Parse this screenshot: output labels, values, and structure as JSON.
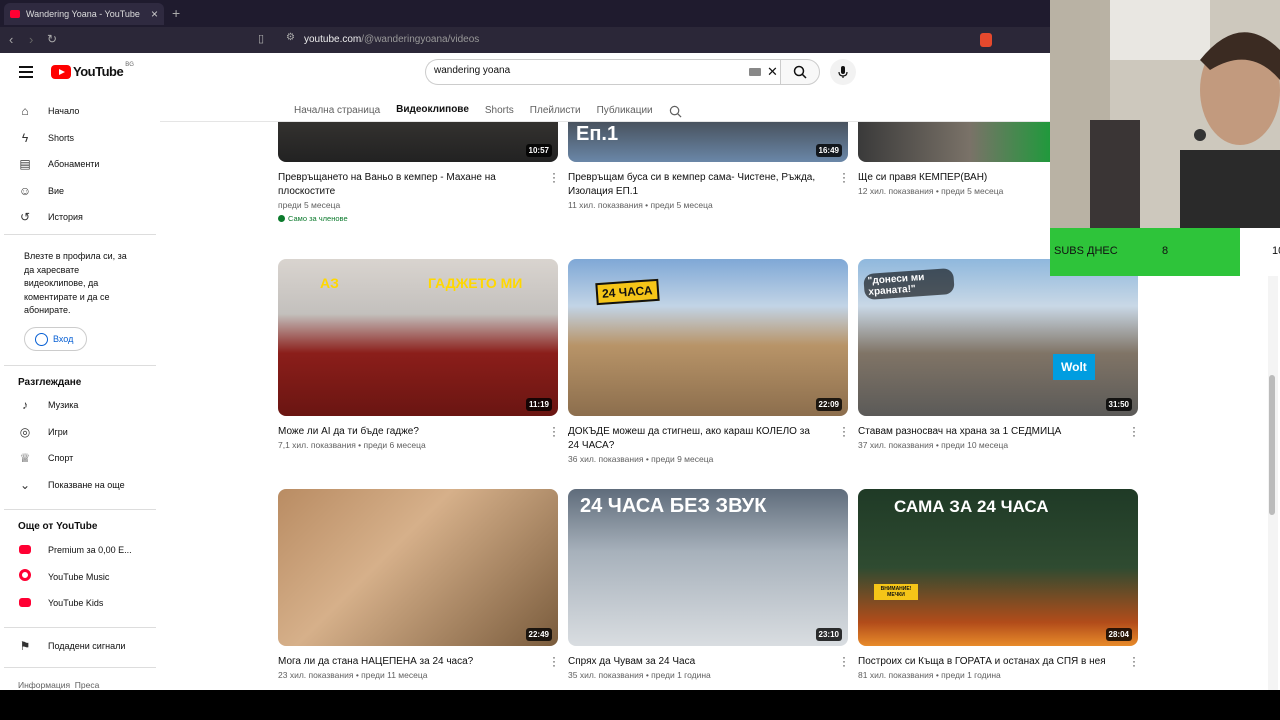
{
  "browser": {
    "tab_title": "Wandering Yoana - YouTube",
    "url_host": "youtube.com",
    "url_path": "/@wanderingyoana/videos"
  },
  "header": {
    "logo_text": "YouTube",
    "country_code": "BG",
    "search_value": "wandering yoana"
  },
  "sidebar": {
    "main_items": [
      {
        "label": "Начало",
        "icon": "home-icon"
      },
      {
        "label": "Shorts",
        "icon": "shorts-icon"
      },
      {
        "label": "Абонаменти",
        "icon": "subscriptions-icon"
      },
      {
        "label": "Вие",
        "icon": "you-icon"
      },
      {
        "label": "История",
        "icon": "history-icon"
      }
    ],
    "signin_note": "Влезте в профила си, за да харесвате видеоклипове, да коментирате и да се абонирате.",
    "signin_label": "Вход",
    "explore_heading": "Разглеждане",
    "explore_items": [
      {
        "label": "Музика",
        "icon": "music-icon"
      },
      {
        "label": "Игри",
        "icon": "gaming-icon"
      },
      {
        "label": "Спорт",
        "icon": "trophy-icon"
      },
      {
        "label": "Показване на още",
        "icon": "chevron-down-icon"
      }
    ],
    "more_heading": "Още от YouTube",
    "more_items": [
      {
        "label": "Premium за 0,00 Е...",
        "icon": "youtube-premium-icon"
      },
      {
        "label": "YouTube Music",
        "icon": "youtube-music-icon"
      },
      {
        "label": "YouTube Kids",
        "icon": "youtube-kids-icon"
      }
    ],
    "report_label": "Подадени сигнали",
    "footer_text": "Информация  Преса"
  },
  "channel_tabs": [
    "Начална страница",
    "Видеоклипове",
    "Shorts",
    "Плейлисти",
    "Публикации"
  ],
  "active_tab": "Видеоклипове",
  "videos": [
    {
      "title": "Превръщането на Ваньо в кемпер - Махане на плоскостите",
      "meta": "преди 5 месеца",
      "duration": "10:57",
      "badge": "Само за членове"
    },
    {
      "title": "Превръщам буса си в кемпер сама- Чистене, Ръжда, Изолация ЕП.1",
      "meta": "11 хил. показвания • преди 5 месеца",
      "duration": "16:49",
      "overlay": "Еп.1"
    },
    {
      "title": "Ще си правя КЕМПЕР(ВАН)",
      "meta": "12 хил. показвания • преди 5 месеца",
      "duration": ""
    },
    {
      "title": "Може ли AI да ти бъде гадже?",
      "meta": "7,1 хил. показвания • преди 6 месеца",
      "duration": "11:19",
      "overlay": "АЗ",
      "overlay2": "ГАДЖЕТО МИ"
    },
    {
      "title": "ДОКЪДЕ можеш да стигнеш, ако караш КОЛЕЛО за 24 ЧАСА?",
      "meta": "36 хил. показвания • преди 9 месеца",
      "duration": "22:09",
      "overlay": "24 ЧАСА"
    },
    {
      "title": "Ставам разносвач на храна за 1 СЕДМИЦА",
      "meta": "37 хил. показвания • преди 10 месеца",
      "duration": "31:50",
      "overlay": "\"донеси ми храната!\"",
      "overlay2": "Wolt"
    },
    {
      "title": "Мога ли да стана НАЦЕПЕНА за 24 часа?",
      "meta": "23 хил. показвания • преди 11 месеца",
      "duration": "22:49"
    },
    {
      "title": "Спрях да Чувам за 24 Часа",
      "meta": "35 хил. показвания • преди 1 година",
      "duration": "23:10",
      "overlay": "24 ЧАСА БЕЗ ЗВУК"
    },
    {
      "title": "Построих си Къща в ГОРАТА и останах да СПЯ в нея",
      "meta": "81 хил. показвания • преди 1 година",
      "duration": "28:04",
      "overlay": "САМА ЗА 24 ЧАСА",
      "overlay2": "ВНИМАНИЕ! МЕЧКИ"
    }
  ],
  "overlay": {
    "subs_label": "SUBS ДНЕС",
    "subs_current": "8",
    "subs_goal": "10"
  }
}
